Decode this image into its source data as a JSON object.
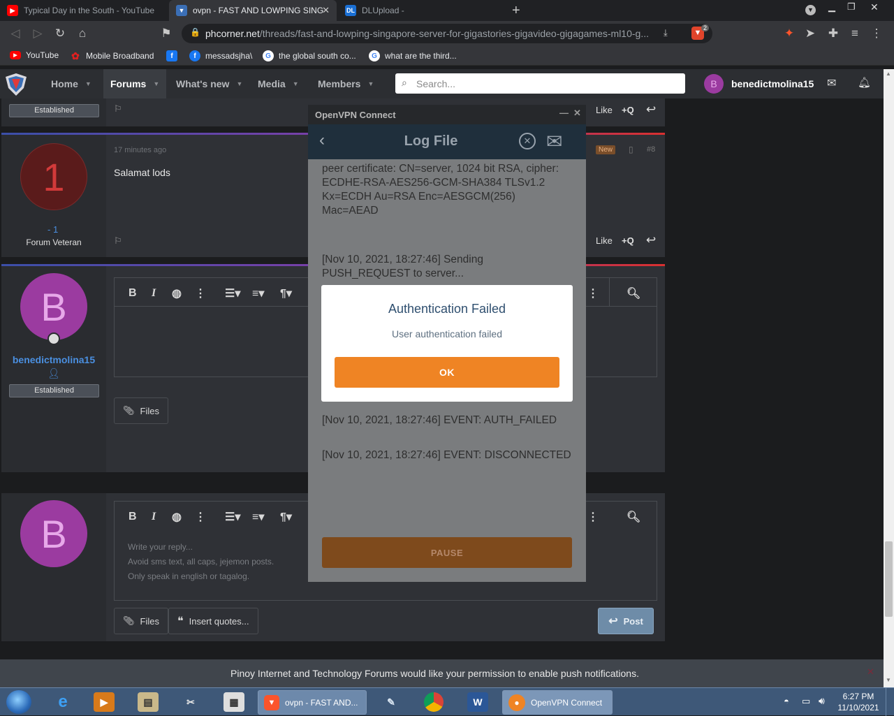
{
  "browser": {
    "tabs": [
      {
        "title": "Typical Day in the South - YouTube",
        "favicon": "youtube-icon"
      },
      {
        "title": "ovpn - FAST AND LOWPING SING",
        "favicon": "phcorner-icon",
        "active": true
      },
      {
        "title": "DLUpload -",
        "favicon": "dlupload-icon"
      }
    ],
    "new_tab_label": "+",
    "url_host": "phcorner.net",
    "url_path": "/threads/fast-and-lowping-singapore-server-for-gigastories-gigavideo-gigagames-ml10-g...",
    "brave_badge": "2",
    "bookmarks": [
      {
        "label": "YouTube",
        "icon": "youtube-icon"
      },
      {
        "label": "Mobile Broadband",
        "icon": "huawei-icon"
      },
      {
        "label": "messadsjha\\",
        "icon": "facebook-icon"
      },
      {
        "label": "the global south co...",
        "icon": "google-icon"
      },
      {
        "label": "what are the third...",
        "icon": "google-icon"
      }
    ]
  },
  "forum_nav": {
    "items": [
      "Home",
      "Forums",
      "What's new",
      "Media",
      "Members"
    ],
    "active": "Forums",
    "search_placeholder": "Search...",
    "username": "benedictmolina15",
    "avatar_letter": "B"
  },
  "posts": {
    "prev_badge": "Established",
    "prev_actions": {
      "like": "Like",
      "quote": "+Q"
    },
    "reply": {
      "time": "17 minutes ago",
      "new_label": "New",
      "number": "#8",
      "text": "Salamat lods",
      "avatar_text": "1",
      "reaction_score": "- 1",
      "user_title": "Forum Veteran",
      "like": "Like",
      "quote": "+Q"
    },
    "editor1": {
      "username": "benedictmolina15",
      "badge": "Established",
      "avatar_letter": "B",
      "files_label": "Files"
    },
    "editor2": {
      "avatar_letter": "B",
      "placeholder_lines": [
        "Write your reply...",
        "Avoid sms text, all caps, jejemon posts.",
        "Only speak in english or tagalog."
      ],
      "files_label": "Files",
      "insert_quotes_label": "Insert quotes...",
      "post_label": "Post"
    }
  },
  "openvpn": {
    "window_title": "OpenVPN Connect",
    "header_title": "Log File",
    "log_top": "peer certificate: CN=server, 1024 bit RSA, cipher: ECDHE-RSA-AES256-GCM-SHA384 TLSv1.2 Kx=ECDH     Au=RSA Enc=AESGCM(256) Mac=AEAD",
    "log_push": "[Nov 10, 2021, 18:27:46] Sending PUSH_REQUEST to server...",
    "log_auth": "[Nov 10, 2021, 18:27:46] EVENT: AUTH_FAILED",
    "log_disc": "[Nov 10, 2021, 18:27:46] EVENT: DISCONNECTED",
    "pause_label": "PAUSE",
    "dialog": {
      "title": "Authentication Failed",
      "message": "User authentication failed",
      "ok_label": "OK"
    }
  },
  "notification": {
    "text": "Pinoy Internet and Technology Forums would like your permission to enable push notifications."
  },
  "taskbar": {
    "tasks": [
      {
        "label": "ovpn - FAST AND...",
        "icon": "brave-icon"
      },
      {
        "label": "OpenVPN Connect",
        "icon": "openvpn-icon"
      }
    ],
    "time": "6:27 PM",
    "date": "11/10/2021"
  },
  "colors": {
    "accent_orange": "#ef8424",
    "avatar_purple": "#9b3ba0",
    "reply_avatar_red": "#5a1b1b",
    "username_blue": "#4a8fe0"
  }
}
